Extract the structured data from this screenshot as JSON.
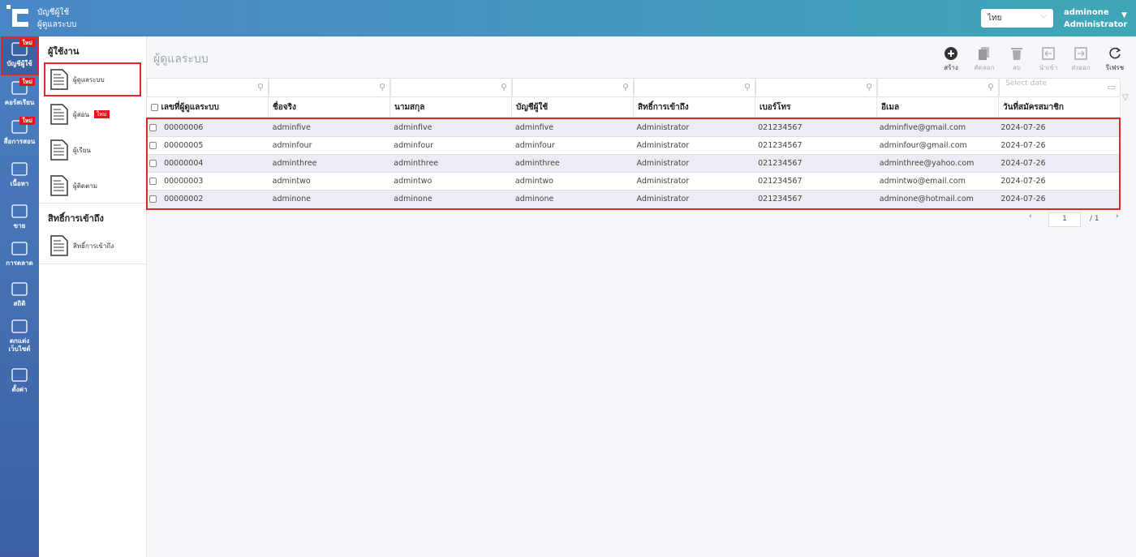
{
  "header": {
    "title_line1": "บัญชีผู้ใช้",
    "title_line2": "ผู้ดูแลระบบ",
    "language": "ไทย",
    "user_name": "adminone",
    "user_role": "Administrator"
  },
  "rail": [
    {
      "label": "บัญชีผู้ใช้",
      "badge": "ใหม่"
    },
    {
      "label": "คอร์สเรียน",
      "badge": "ใหม่"
    },
    {
      "label": "สื่อการสอน",
      "badge": "ใหม่"
    },
    {
      "label": "เนื้อหา"
    },
    {
      "label": "ขาย"
    },
    {
      "label": "การตลาด"
    },
    {
      "label": "สถิติ"
    },
    {
      "label": "ตกแต่งเว็บไซต์"
    },
    {
      "label": "ตั้งค่า"
    }
  ],
  "submenu": {
    "group1": "ผู้ใช้งาน",
    "items1": [
      {
        "label": "ผู้ดูแลระบบ"
      },
      {
        "label": "ผู้สอน",
        "badge": "ใหม่"
      },
      {
        "label": "ผู้เรียน"
      },
      {
        "label": "ผู้ติดตาม"
      }
    ],
    "group2": "สิทธิ์การเข้าถึง",
    "items2": [
      {
        "label": "สิทธิ์การเข้าถึง"
      }
    ]
  },
  "page_title": "ผู้ดูแลระบบ",
  "toolbar": {
    "create": "สร้าง",
    "copy": "คัดลอก",
    "delete": "ลบ",
    "import": "นำเข้า",
    "export": "ส่งออก",
    "refresh": "รีเฟรช"
  },
  "table": {
    "date_placeholder": "Select date",
    "columns": [
      "เลขที่ผู้ดูแลระบบ",
      "ชื่อจริง",
      "นามสกุล",
      "บัญชีผู้ใช้",
      "สิทธิ์การเข้าถึง",
      "เบอร์โทร",
      "อีเมล",
      "วันที่สมัครสมาชิก"
    ],
    "rows": [
      [
        "00000006",
        "adminfive",
        "adminfive",
        "adminfive",
        "Administrator",
        "021234567",
        "adminfive@gmail.com",
        "2024-07-26"
      ],
      [
        "00000005",
        "adminfour",
        "adminfour",
        "adminfour",
        "Administrator",
        "021234567",
        "adminfour@gmail.com",
        "2024-07-26"
      ],
      [
        "00000004",
        "adminthree",
        "adminthree",
        "adminthree",
        "Administrator",
        "021234567",
        "adminthree@yahoo.com",
        "2024-07-26"
      ],
      [
        "00000003",
        "admintwo",
        "admintwo",
        "admintwo",
        "Administrator",
        "021234567",
        "admintwo@email.com",
        "2024-07-26"
      ],
      [
        "00000002",
        "adminone",
        "adminone",
        "adminone",
        "Administrator",
        "021234567",
        "adminone@hotmail.com",
        "2024-07-26"
      ]
    ]
  },
  "pagination": {
    "page": "1",
    "total": "/ 1"
  }
}
